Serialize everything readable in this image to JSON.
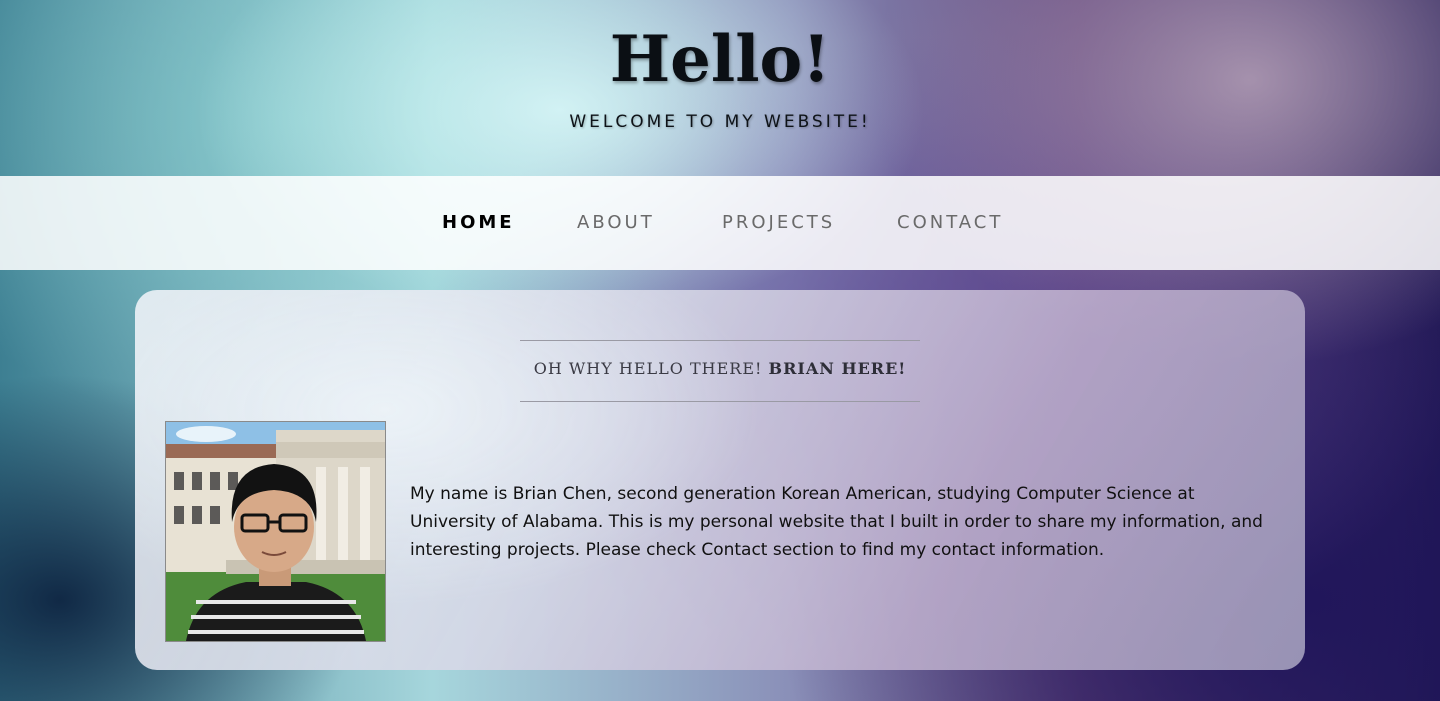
{
  "header": {
    "title": "Hello!",
    "subtitle": "WELCOME TO MY WEBSITE!"
  },
  "nav": {
    "items": [
      {
        "label": "HOME",
        "active": true
      },
      {
        "label": "ABOUT",
        "active": false
      },
      {
        "label": "PROJECTS",
        "active": false
      },
      {
        "label": "CONTACT",
        "active": false
      }
    ]
  },
  "main": {
    "intro_heading_prefix": "OH WHY HELLO THERE! ",
    "intro_heading_bold": "BRIAN HERE!",
    "bio": "My name is Brian Chen, second generation Korean American, studying Computer Science at University of Alabama. This is my personal website that I built in order to share my information, and interesting projects. Please check Contact section to find my contact information."
  },
  "colors": {
    "nav_active": "#000000",
    "nav_inactive": "#6a6a6a",
    "nav_background": "#ffffff"
  }
}
